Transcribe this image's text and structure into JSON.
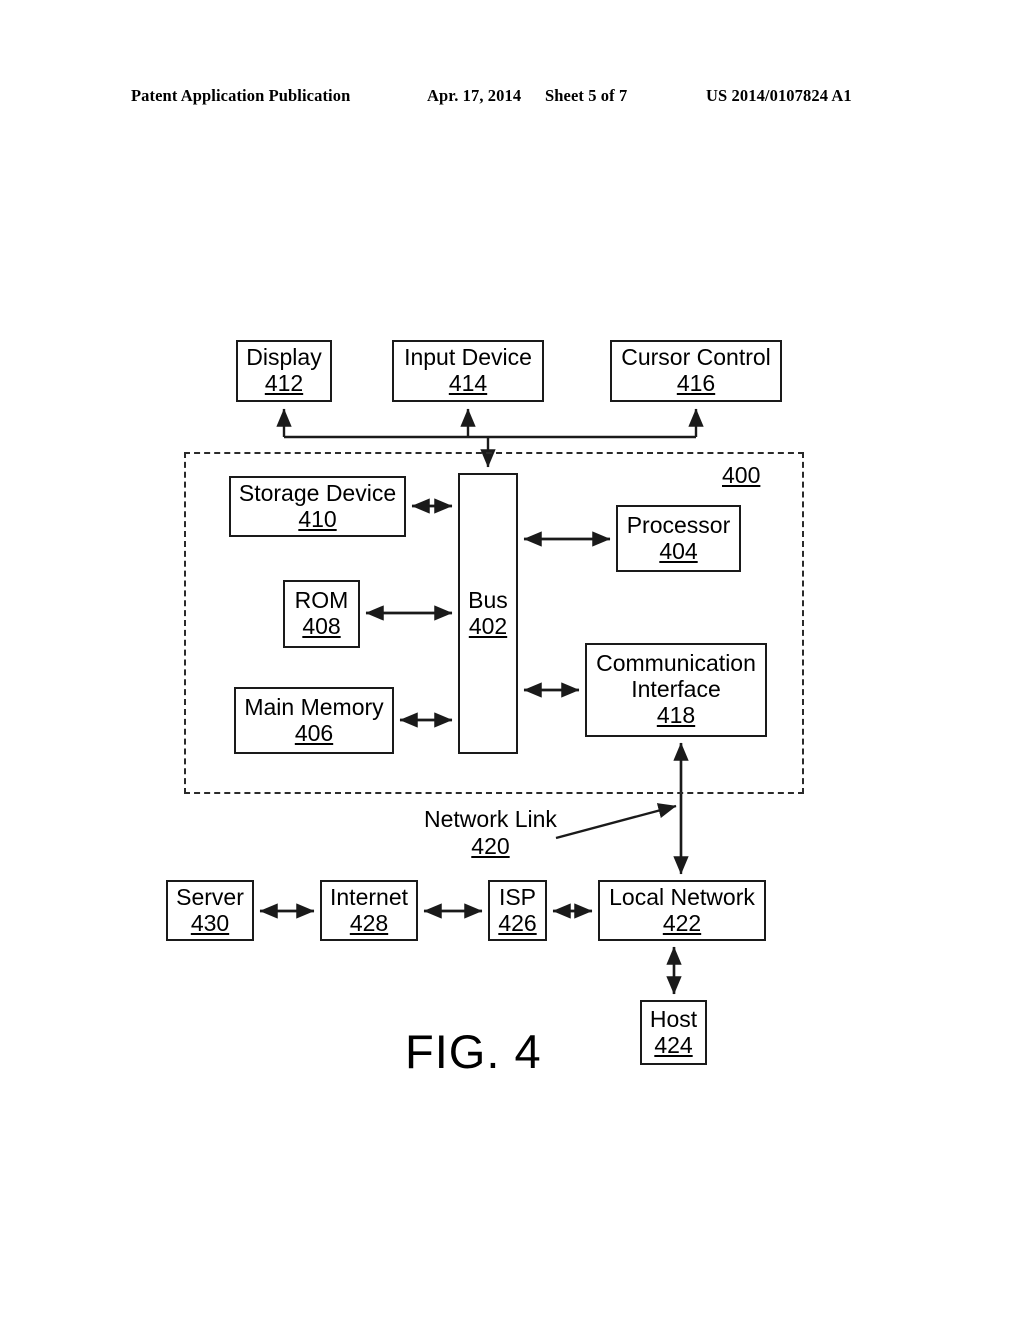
{
  "header": {
    "publication": "Patent Application Publication",
    "date": "Apr. 17, 2014",
    "sheet": "Sheet 5 of 7",
    "patent_number": "US 2014/0107824 A1"
  },
  "figure": {
    "caption": "FIG. 4",
    "system_reference": "400",
    "boxes": {
      "display": {
        "label": "Display",
        "number": "412"
      },
      "input_device": {
        "label": "Input Device",
        "number": "414"
      },
      "cursor_control": {
        "label": "Cursor Control",
        "number": "416"
      },
      "storage_device": {
        "label": "Storage Device",
        "number": "410"
      },
      "rom": {
        "label": "ROM",
        "number": "408"
      },
      "main_memory": {
        "label": "Main Memory",
        "number": "406"
      },
      "bus": {
        "label": "Bus",
        "number": "402"
      },
      "processor": {
        "label": "Processor",
        "number": "404"
      },
      "comm_interface": {
        "label_line1": "Communication",
        "label_line2": "Interface",
        "number": "418"
      },
      "server": {
        "label": "Server",
        "number": "430"
      },
      "internet": {
        "label": "Internet",
        "number": "428"
      },
      "isp": {
        "label": "ISP",
        "number": "426"
      },
      "local_network": {
        "label": "Local Network",
        "number": "422"
      },
      "host": {
        "label": "Host",
        "number": "424"
      }
    },
    "annotations": {
      "network_link": {
        "label": "Network Link",
        "number": "420"
      }
    },
    "colors": {
      "stroke": "#1a1a1a",
      "background": "#ffffff",
      "enclosure_stroke": "#2a2a2a"
    }
  }
}
